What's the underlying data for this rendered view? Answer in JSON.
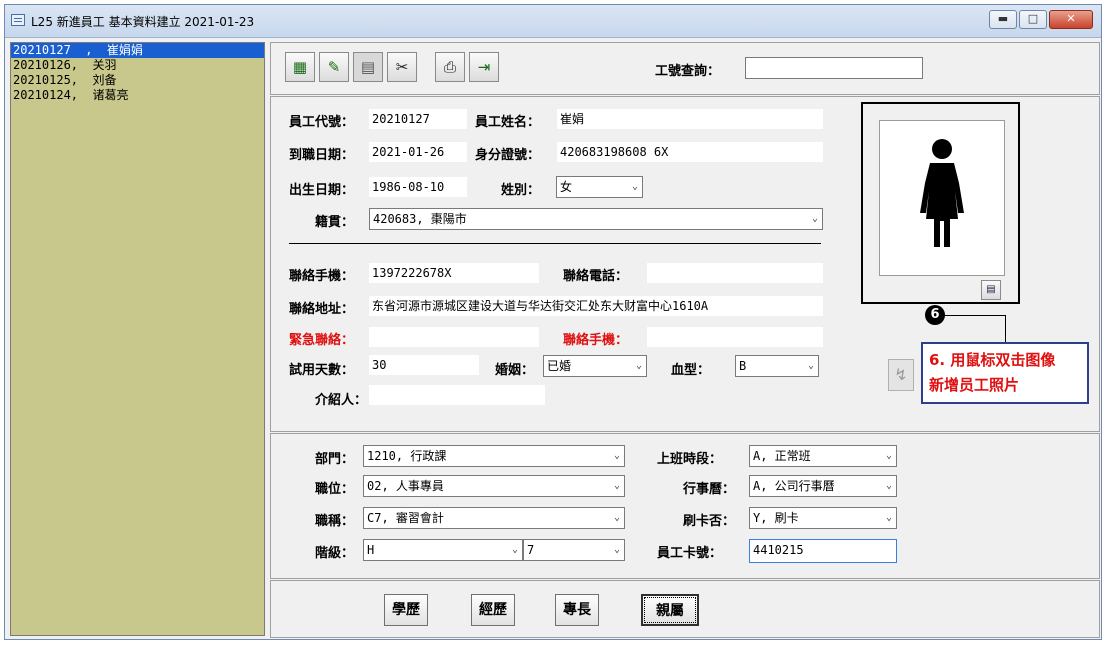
{
  "window": {
    "title": "L25 新進員工 基本資料建立  2021-01-23",
    "buttons": [
      "minimize",
      "maximize",
      "close"
    ]
  },
  "employee_list": [
    {
      "text": "20210127  ,  崔娟娟",
      "selected": true
    },
    {
      "text": "20210126,  关羽",
      "selected": false
    },
    {
      "text": "20210125,  刘备",
      "selected": false
    },
    {
      "text": "20210124,  诸葛亮",
      "selected": false
    }
  ],
  "toolbar": {
    "icons": [
      "add-record-icon",
      "edit-record-icon",
      "delete-record-icon",
      "cut-icon",
      "print-icon",
      "exit-icon"
    ],
    "search_label": "工號查詢：",
    "search_value": ""
  },
  "info": {
    "emp_id_label": "員工代號：",
    "emp_id": "20210127",
    "emp_name_label": "員工姓名：",
    "emp_name": "崔娟",
    "hire_date_label": "到職日期：",
    "hire_date": "2021-01-26",
    "id_card_label": "身分證號：",
    "id_card": "420683198608  6X",
    "birth_label": "出生日期：",
    "birth": "1986-08-10",
    "gender_label": "姓別：",
    "gender": "女",
    "origin_label": "籍貫：",
    "origin": "420683, 棗陽市",
    "mobile_label": "聯絡手機：",
    "mobile": "1397222678X",
    "phone_label": "聯絡電話：",
    "phone": "",
    "address_label": "聯絡地址：",
    "address": "东省河源市源城区建设大道与华达街交汇处东大财富中心1610A",
    "emergency_label": "緊急聯絡：",
    "emergency": "",
    "emergency_mobile_label": "聯絡手機：",
    "emergency_mobile": "",
    "probation_label": "試用天數：",
    "probation": "30",
    "marriage_label": "婚姻：",
    "marriage": "已婚",
    "blood_label": "血型：",
    "blood": "B",
    "referrer_label": "介紹人：",
    "referrer": ""
  },
  "callout": {
    "number": "6",
    "line1": "6. 用鼠标双击图像",
    "line2": "新增员工照片"
  },
  "org": {
    "dept_label": "部門：",
    "dept": "1210, 行政課",
    "shift_label": "上班時段：",
    "shift": "A, 正常班",
    "position_label": "職位：",
    "position": "02, 人事專員",
    "calendar_label": "行事曆：",
    "calendar": "A, 公司行事曆",
    "title_label": "職稱：",
    "title": "C7, 審習會計",
    "card_label": "刷卡否：",
    "card": "Y, 刷卡",
    "grade_label": "階級：",
    "grade": "H",
    "grade2": "7",
    "card_no_label": "員工卡號：",
    "card_no": "4410215"
  },
  "bottom_buttons": [
    "學歷",
    "經歷",
    "專長",
    "親屬"
  ]
}
